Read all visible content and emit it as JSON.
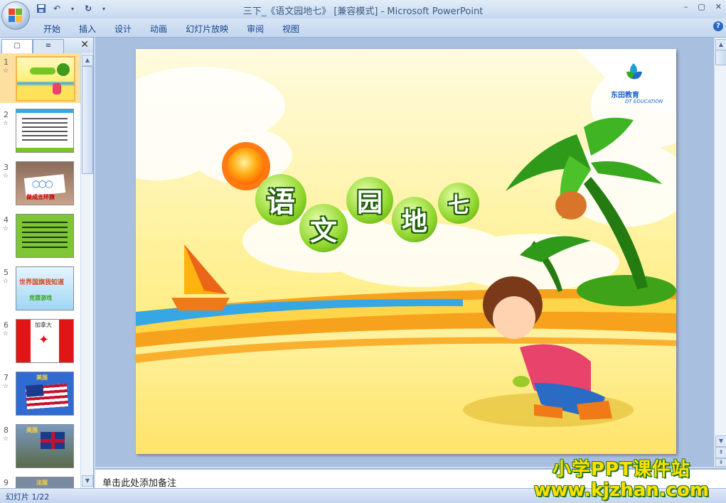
{
  "window": {
    "title": "三下_《语文园地七》 [兼容模式] - Microsoft PowerPoint",
    "controls": [
      "–",
      "▢",
      "✕"
    ]
  },
  "quick_access": {
    "save_icon": "save-icon",
    "undo_icon": "undo-icon",
    "redo_icon": "redo-icon",
    "customize_icon": "chevron-down-icon"
  },
  "ribbon": {
    "tabs": [
      "开始",
      "插入",
      "设计",
      "动画",
      "幻灯片放映",
      "审阅",
      "视图"
    ],
    "help": "?"
  },
  "left_pane": {
    "tab_slides": "▢",
    "tab_outline": "≡",
    "close": "✕",
    "thumbnails": [
      {
        "num": "1",
        "selected": true
      },
      {
        "num": "2",
        "selected": false
      },
      {
        "num": "3",
        "selected": false
      },
      {
        "num": "4",
        "selected": false
      },
      {
        "num": "5",
        "selected": false
      },
      {
        "num": "6",
        "selected": false
      },
      {
        "num": "7",
        "selected": false
      },
      {
        "num": "8",
        "selected": false
      },
      {
        "num": "9",
        "selected": false
      }
    ],
    "thumb_labels": {
      "t3": "做成五环旗",
      "t5a": "世界国旗我知道",
      "t5b": "竞猜游戏",
      "t6": "加拿大",
      "t7": "美国",
      "t8": "英国",
      "t9": "法国"
    }
  },
  "slide": {
    "title_chars": [
      "语",
      "文",
      "园",
      "地",
      "七"
    ],
    "logo_text": "东田教育",
    "logo_sub": "DT EDUCATION"
  },
  "notes": {
    "placeholder": "单击此处添加备注"
  },
  "status": {
    "slide_info": "幻灯片 1/22"
  },
  "watermark": {
    "line1": "小学PPT课件站",
    "line2": "www.kjzhan.com"
  },
  "colors": {
    "slide_sky": "#fff6b0",
    "slide_sand": "#ffe25a",
    "sea": "#37a6e4",
    "accent_green": "#66b81c",
    "selected_thumb": "#fde0a0"
  }
}
